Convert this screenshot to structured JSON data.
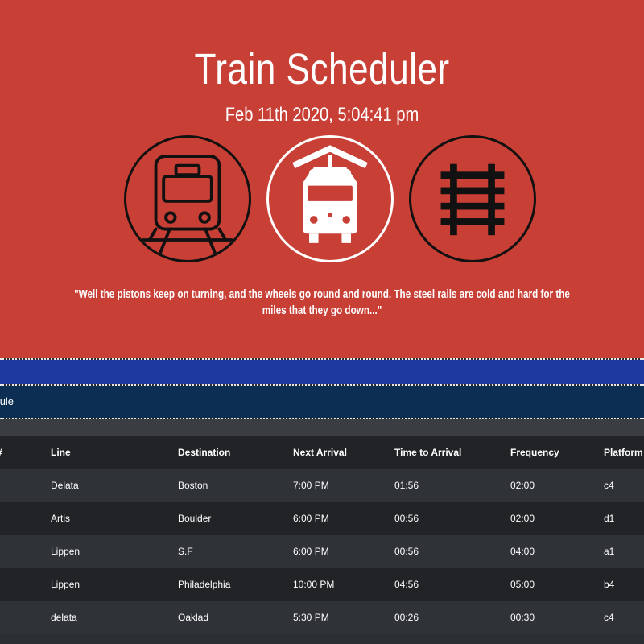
{
  "header": {
    "title": "Train Scheduler",
    "datetime": "Feb 11th 2020, 5:04:41 pm",
    "icons": [
      "train-front-icon",
      "tram-icon",
      "railroad-tracks-icon"
    ],
    "quote": "\"Well the pistons keep on turning, and the wheels go round and round. The steel rails are cold and hard for the miles that they go down...\""
  },
  "panel": {
    "title": "hedule"
  },
  "table": {
    "columns": [
      "#",
      "Line",
      "Destination",
      "Next Arrival",
      "Time to Arrival",
      "Frequency",
      "Platform #"
    ],
    "rows": [
      [
        "",
        "Delata",
        "Boston",
        "7:00 PM",
        "01:56",
        "02:00",
        "c4"
      ],
      [
        "",
        "Artis",
        "Boulder",
        "6:00 PM",
        "00:56",
        "02:00",
        "d1"
      ],
      [
        "",
        "Lippen",
        "S.F",
        "6:00 PM",
        "00:56",
        "04:00",
        "a1"
      ],
      [
        "",
        "Lippen",
        "Philadelphia",
        "10:00 PM",
        "04:56",
        "05:00",
        "b4"
      ],
      [
        "",
        "delata",
        "Oaklad",
        "5:30 PM",
        "00:26",
        "00:30",
        "c4"
      ]
    ]
  },
  "colors": {
    "hero": "#c83f35",
    "band": "#1e3aa0",
    "panel": "#0b2e52",
    "row_dark": "#212327",
    "row_light": "#2f3236"
  }
}
